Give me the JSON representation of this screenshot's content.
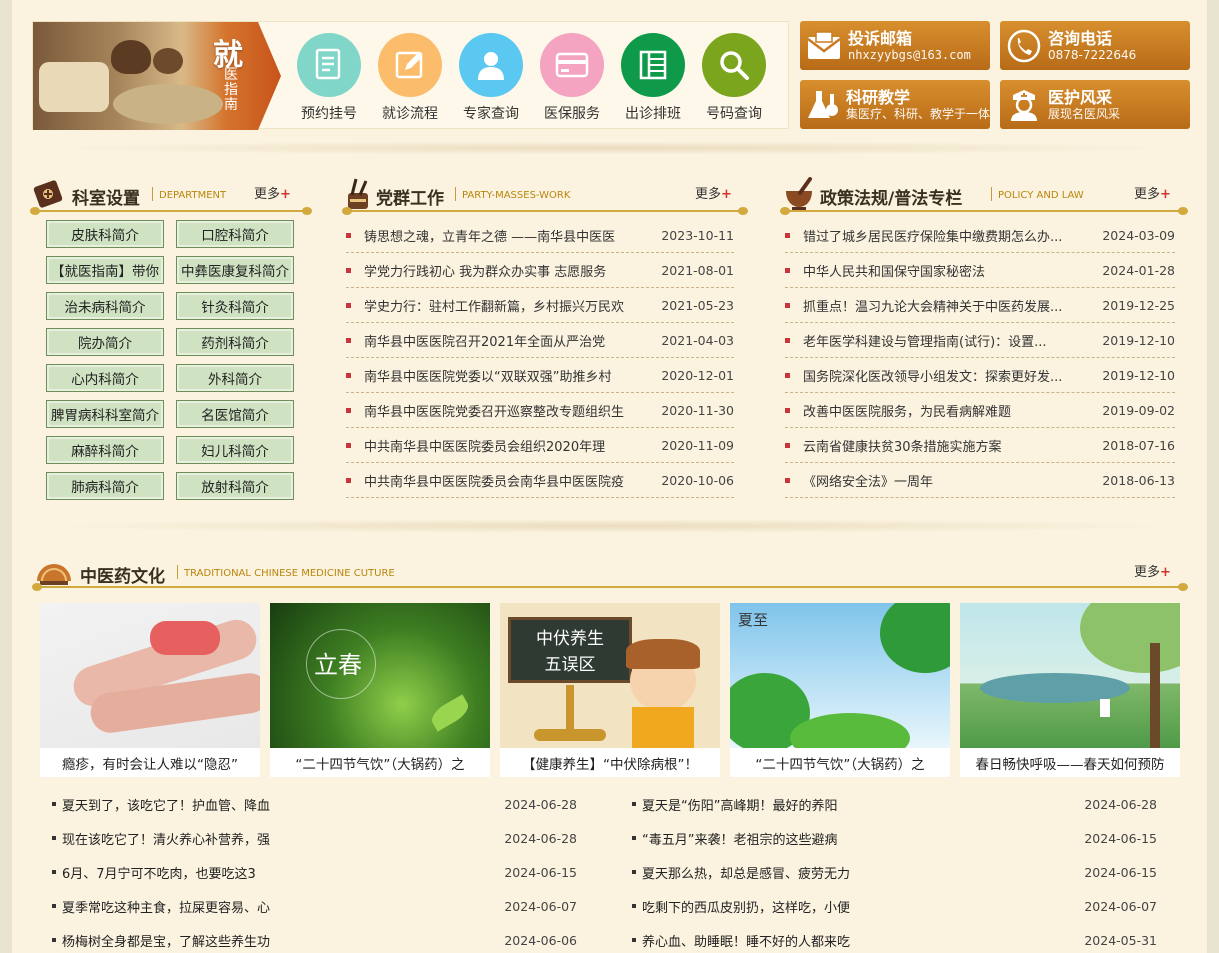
{
  "guide": {
    "banner_big": "就",
    "banner_small": "医指南",
    "items": [
      {
        "label": "预约挂号",
        "color": "#7fd6c9"
      },
      {
        "label": "就诊流程",
        "color": "#fbbd6b"
      },
      {
        "label": "专家查询",
        "color": "#5bc8f2"
      },
      {
        "label": "医保服务",
        "color": "#f4a3c0"
      },
      {
        "label": "出诊排班",
        "color": "#0f9a4a"
      },
      {
        "label": "号码查询",
        "color": "#7aa51c"
      }
    ]
  },
  "tiles": {
    "complaint": {
      "title": "投诉邮箱",
      "sub": "nhxzyybgs@163.com"
    },
    "phone": {
      "title": "咨询电话",
      "sub": "0878-7222646"
    },
    "research": {
      "title": "科研教学",
      "sub": "集医疗、科研、教学于一体"
    },
    "style": {
      "title": "医护风采",
      "sub": "展现名医风采"
    }
  },
  "dept": {
    "title": "科室设置",
    "en": "DEPARTMENT",
    "more": "更多",
    "plus": "+",
    "items": [
      "皮肤科简介",
      "口腔科简介",
      "【就医指南】带你",
      "中彝医康复科简介",
      "治未病科简介",
      "针灸科简介",
      "院办简介",
      "药剂科简介",
      "心内科简介",
      "外科简介",
      "脾胃病科科室简介",
      "名医馆简介",
      "麻醉科简介",
      "妇儿科简介",
      "肺病科简介",
      "放射科简介"
    ]
  },
  "party": {
    "title": "党群工作",
    "en": "PARTY-MASSES-WORK",
    "more": "更多",
    "plus": "+",
    "items": [
      {
        "title": "铸思想之魂，立青年之德 ——南华县中医医",
        "date": "2023-10-11"
      },
      {
        "title": "学党力行践初心 我为群众办实事 志愿服务",
        "date": "2021-08-01"
      },
      {
        "title": "学史力行：驻村工作翻新篇，乡村振兴万民欢",
        "date": "2021-05-23"
      },
      {
        "title": "南华县中医医院召开2021年全面从严治党",
        "date": "2021-04-03"
      },
      {
        "title": "南华县中医医院党委以“双联双强”助推乡村",
        "date": "2020-12-01"
      },
      {
        "title": "南华县中医医院党委召开巡察整改专题组织生",
        "date": "2020-11-30"
      },
      {
        "title": "中共南华县中医医院委员会组织2020年理",
        "date": "2020-11-09"
      },
      {
        "title": "中共南华县中医医院委员会南华县中医医院疫",
        "date": "2020-10-06"
      }
    ]
  },
  "policy": {
    "title": "政策法规/普法专栏",
    "en": "POLICY AND LAW",
    "more": "更多",
    "plus": "+",
    "items": [
      {
        "title": "错过了城乡居民医疗保险集中缴费期怎么办...",
        "date": "2024-03-09"
      },
      {
        "title": "中华人民共和国保守国家秘密法",
        "date": "2024-01-28"
      },
      {
        "title": "抓重点！温习九论大会精神关于中医药发展...",
        "date": "2019-12-25"
      },
      {
        "title": "老年医学科建设与管理指南(试行)：设置...",
        "date": "2019-12-10"
      },
      {
        "title": "国务院深化医改领导小组发文：探索更好发...",
        "date": "2019-12-10"
      },
      {
        "title": "改善中医医院服务，为民看病解难题",
        "date": "2019-09-02"
      },
      {
        "title": "云南省健康扶贫30条措施实施方案",
        "date": "2018-07-16"
      },
      {
        "title": "《网络安全法》一周年",
        "date": "2018-06-13"
      }
    ]
  },
  "culture": {
    "title": "中医药文化",
    "en": "TRADITIONAL CHINESE MEDICINE CUTURE",
    "more": "更多",
    "plus": "+",
    "cards": [
      {
        "caption": "瘾疹，有时会让人难以“隐忍”"
      },
      {
        "caption": "“二十四节气饮”（大锅药）之",
        "pic_text": "立春"
      },
      {
        "caption": "【健康养生】“中伏除病根”！",
        "pic_text_1": "中伏养生",
        "pic_text_2": "五误区"
      },
      {
        "caption": "“二十四节气饮”（大锅药）之",
        "pic_text": "夏至"
      },
      {
        "caption": "春日畅快呼吸——春天如何预防"
      }
    ],
    "left_list": [
      {
        "title": "夏天到了，该吃它了！护血管、降血",
        "date": "2024-06-28"
      },
      {
        "title": "现在该吃它了！清火养心补营养，强",
        "date": "2024-06-28"
      },
      {
        "title": "6月、7月宁可不吃肉，也要吃这3",
        "date": "2024-06-15"
      },
      {
        "title": "夏季常吃这种主食，拉屎更容易、心",
        "date": "2024-06-07"
      },
      {
        "title": "杨梅树全身都是宝，了解这些养生功",
        "date": "2024-06-06"
      }
    ],
    "right_list": [
      {
        "title": "夏天是“伤阳”高峰期！最好的养阳",
        "date": "2024-06-28"
      },
      {
        "title": "“毒五月”来袭！老祖宗的这些避病",
        "date": "2024-06-15"
      },
      {
        "title": "夏天那么热，却总是感冒、疲劳无力",
        "date": "2024-06-15"
      },
      {
        "title": "吃剩下的西瓜皮别扔，这样吃，小便",
        "date": "2024-06-07"
      },
      {
        "title": "养心血、助睡眠！睡不好的人都来吃",
        "date": "2024-05-31"
      }
    ]
  },
  "colors": {
    "accent_gold": "#d2a93c",
    "tile_orange": "#c97a22",
    "bullet_red": "#c9343a",
    "dept_green": "#cfe2c1"
  }
}
